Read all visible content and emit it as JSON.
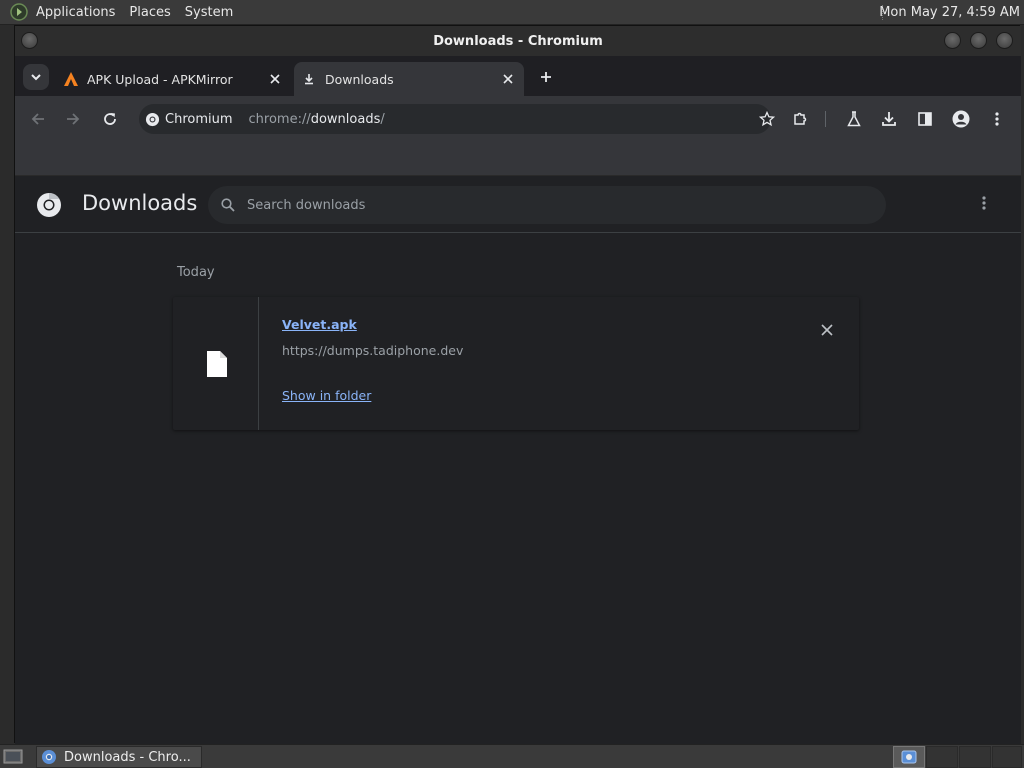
{
  "top_panel": {
    "menus": [
      "Applications",
      "Places",
      "System"
    ],
    "clock": "Mon May 27,  4:59 AM"
  },
  "window": {
    "title": "Downloads - Chromium"
  },
  "tabs": [
    {
      "title": "APK Upload - APKMirror",
      "active": false
    },
    {
      "title": "Downloads",
      "active": true
    }
  ],
  "omnibox": {
    "chip_label": "Chromium",
    "url_scheme": "chrome://",
    "url_host": "downloads",
    "url_path": "/"
  },
  "page": {
    "title": "Downloads",
    "search_placeholder": "Search downloads",
    "date_group": "Today",
    "items": [
      {
        "file_name": "Velvet.apk",
        "url": "https://dumps.tadiphone.dev",
        "action_label": "Show in folder"
      }
    ]
  },
  "taskbar": {
    "task_label": "Downloads - Chro..."
  },
  "colors": {
    "accent_link": "#8ab4f8",
    "page_bg": "#202124",
    "toolbar_bg": "#35363a",
    "apk_mirror_orange": "#f58220"
  }
}
